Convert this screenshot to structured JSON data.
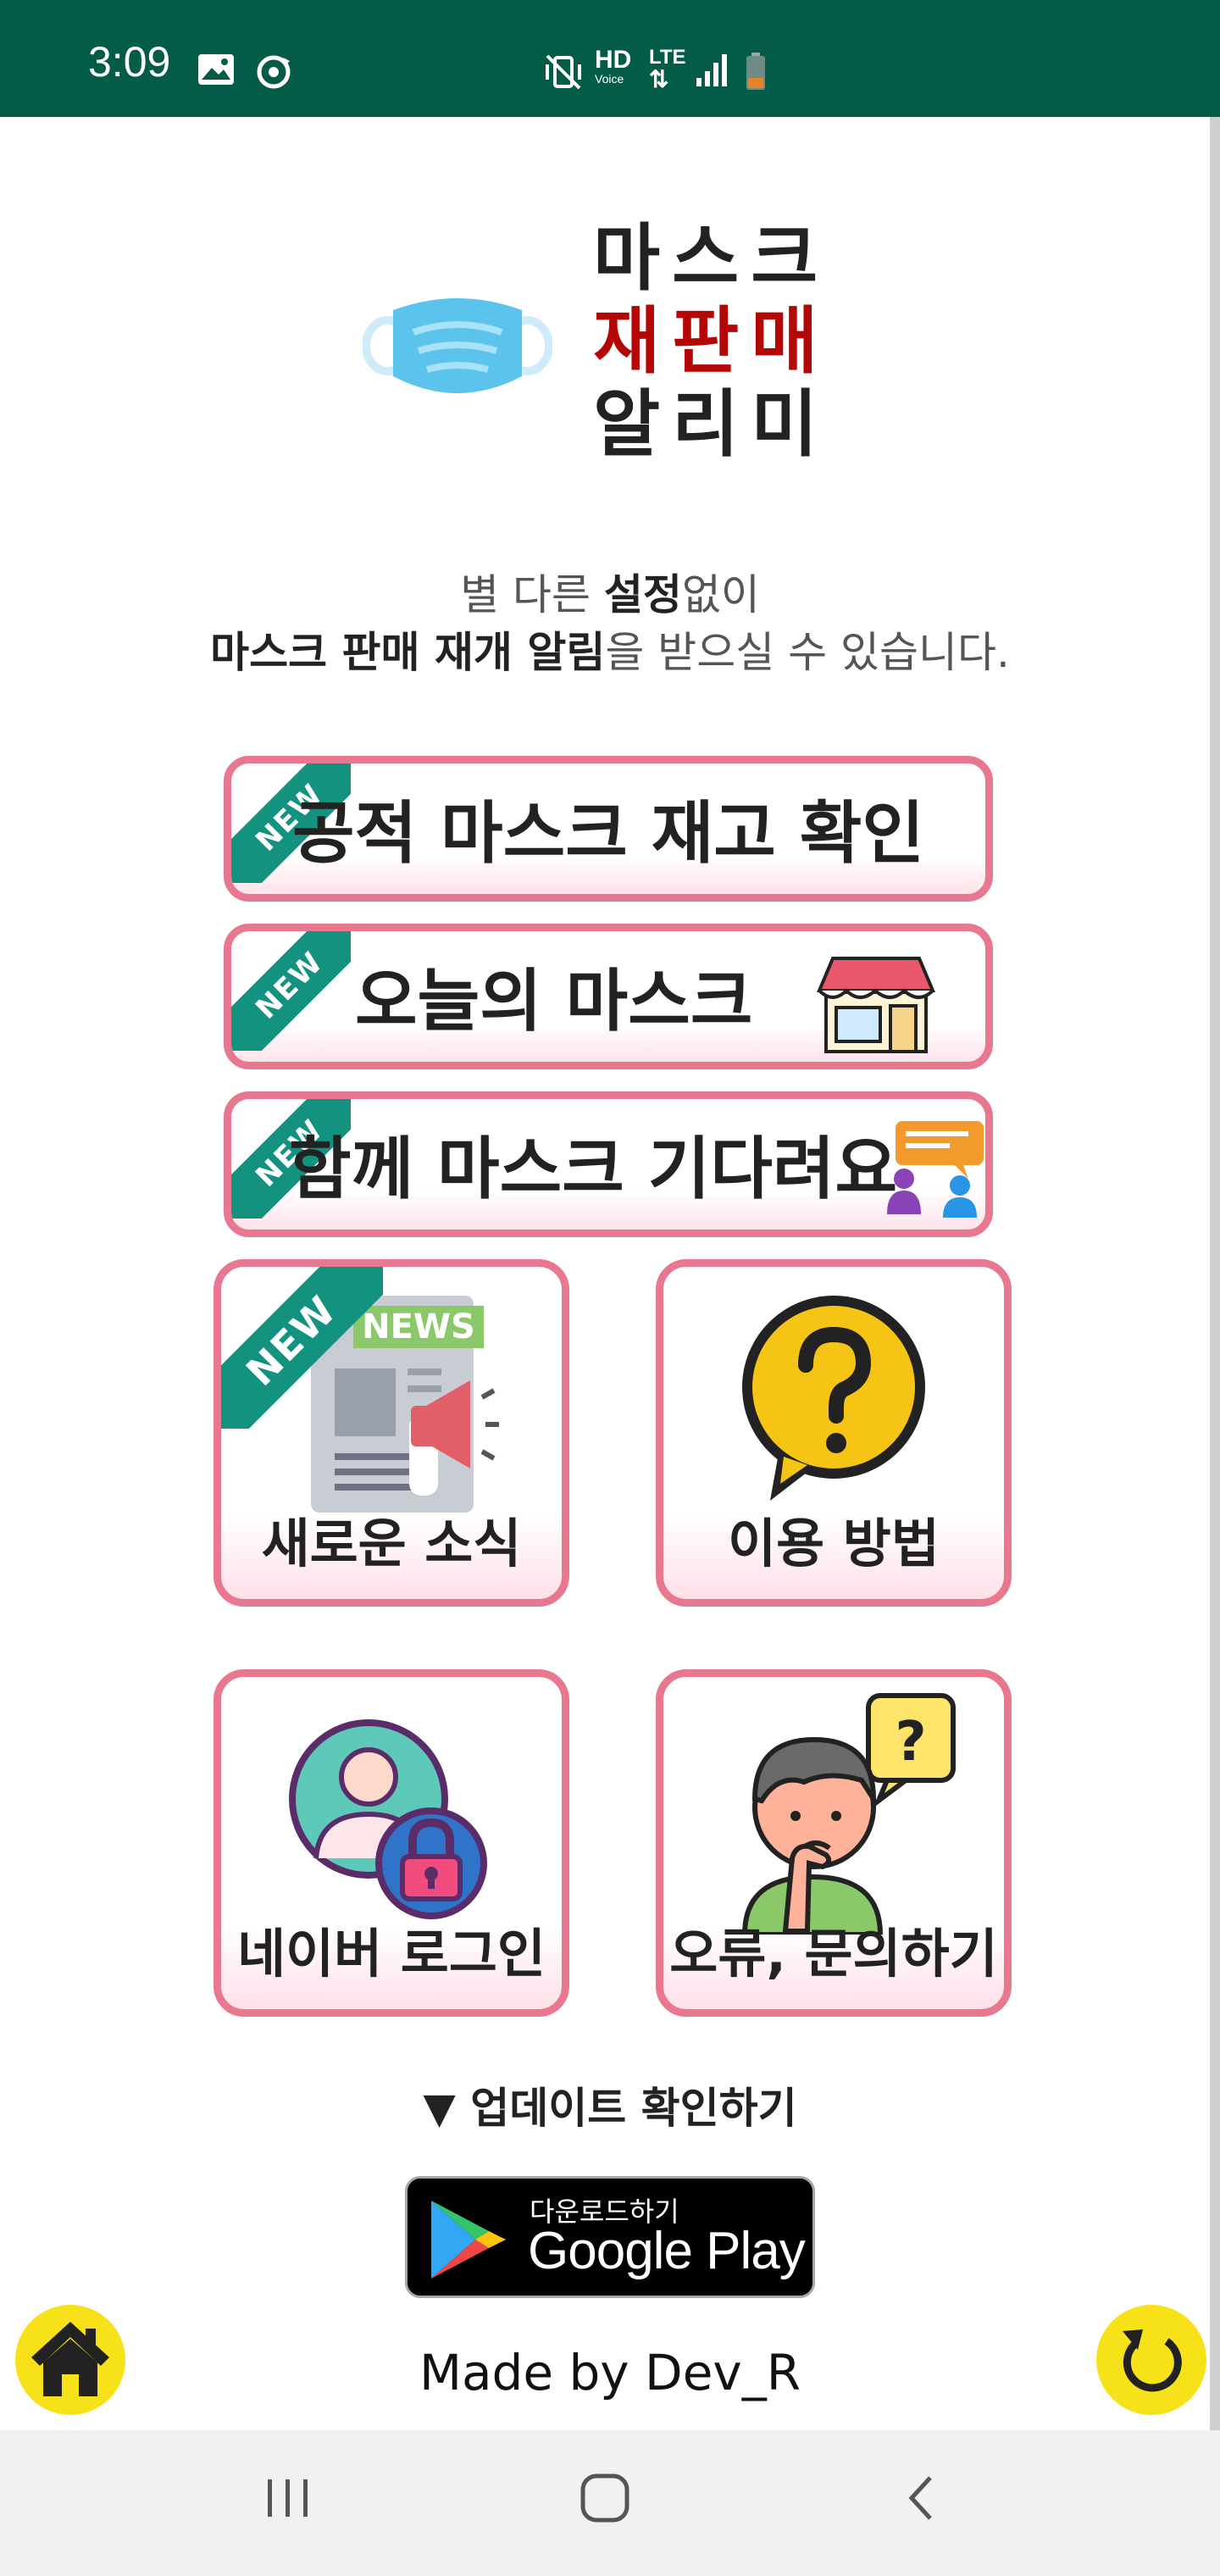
{
  "status_bar": {
    "time": "3:09",
    "network": "LTE",
    "hd_label": "HD",
    "voice_label": "Voice",
    "icons": [
      "image-icon",
      "sync-icon",
      "mute-vibrate-icon",
      "hd-voice-icon",
      "lte-icon",
      "signal-icon",
      "battery-icon"
    ],
    "bg_color": "#045c48"
  },
  "logo": {
    "line1": "마스크",
    "line2": "재판매",
    "line3": "알리미",
    "line1_color": "#222222",
    "line2_color": "#b50606",
    "line3_color": "#222222"
  },
  "subtitle": {
    "l1_part1": "별 다른 ",
    "l1_bold": "설정",
    "l1_part2": "없이",
    "l2_bold": "마스크 판매 재개 알림",
    "l2_part2": "을 받으실 수 있습니다."
  },
  "menu": {
    "ribbon": "NEW",
    "stock_check": "공적 마스크 재고 확인",
    "today_mask": "오늘의 마스크",
    "wait_together": "함께 마스크 기다려요",
    "news": "새로운 소식",
    "news_badge": "NEWS",
    "how_to_use": "이용 방법",
    "naver_login": "네이버 로그인",
    "report": "오류, 문의하기"
  },
  "update": {
    "label": "▼ 업데이트 확인하기",
    "store_small": "다운로드하기",
    "store_big": "Google Play"
  },
  "footer": {
    "made_by": "Made by Dev_R"
  },
  "colors": {
    "accent_border": "#e8788f",
    "ribbon": "#13927f",
    "fab": "#f7e21a"
  }
}
